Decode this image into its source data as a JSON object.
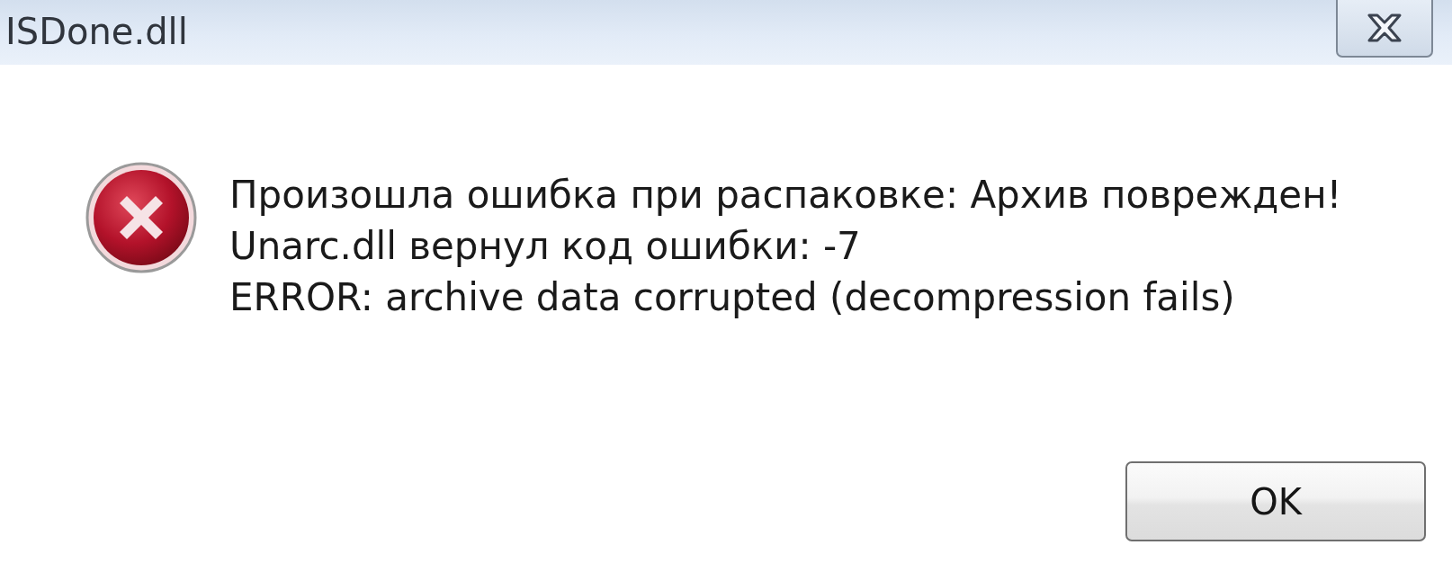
{
  "window": {
    "title": "ISDone.dll"
  },
  "message": {
    "kind": "error",
    "lines": [
      "Произошла ошибка при распаковке: Архив поврежден!",
      "Unarc.dll вернул код ошибки: -7",
      "ERROR: archive data corrupted (decompression fails)"
    ]
  },
  "buttons": [
    {
      "label": "OK"
    }
  ]
}
